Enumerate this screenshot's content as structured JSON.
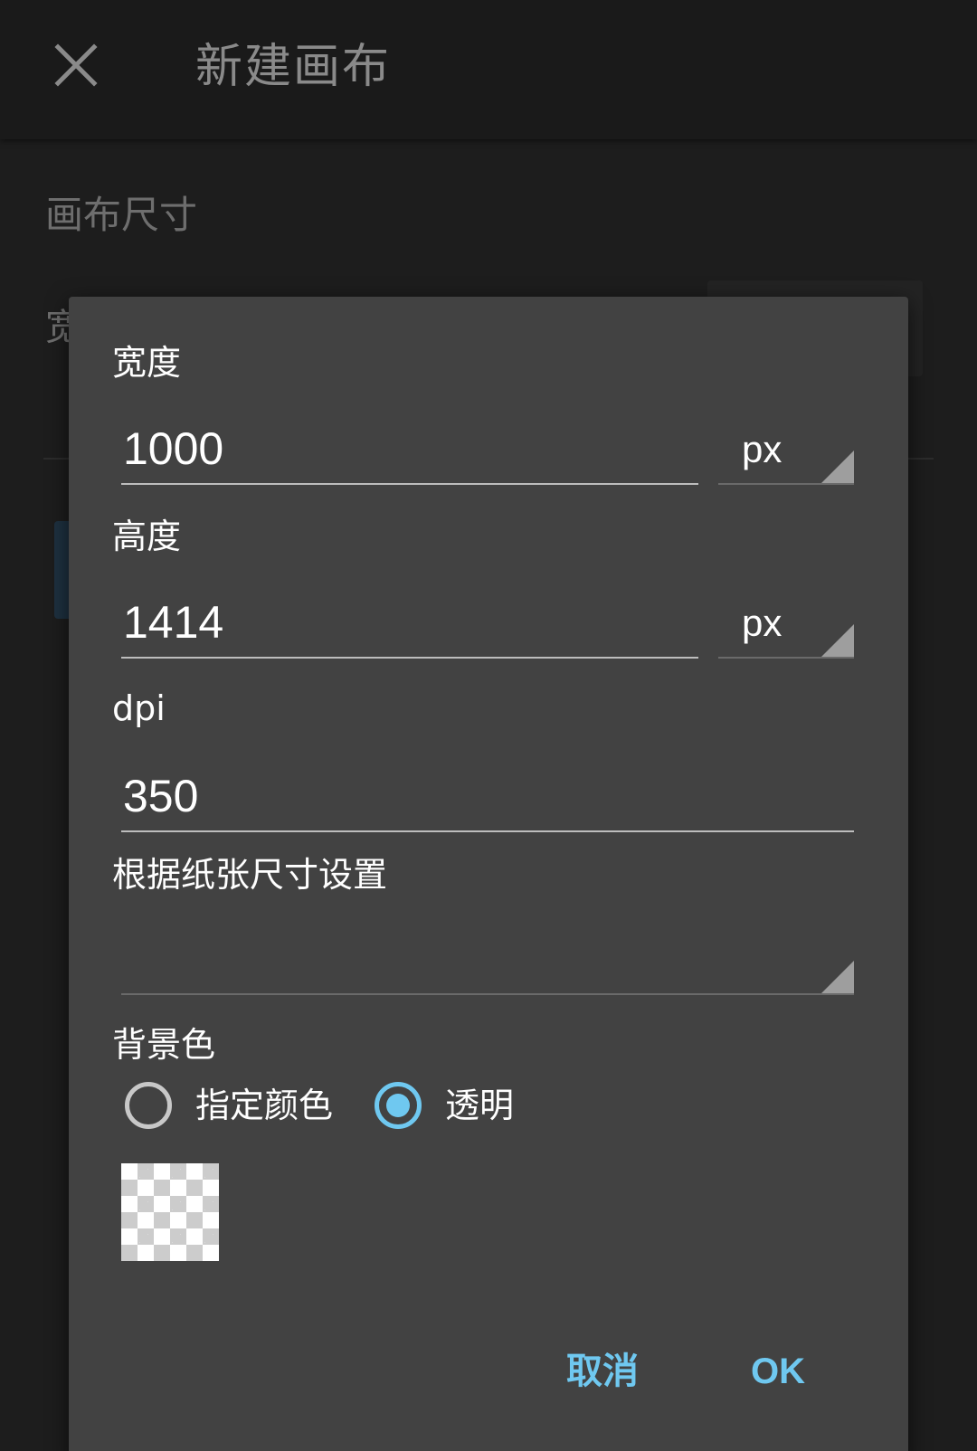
{
  "appbar": {
    "title": "新建画布",
    "close_icon": "close-icon"
  },
  "background": {
    "section_title": "画布尺寸",
    "row_label": "宽"
  },
  "dialog": {
    "width": {
      "label": "宽度",
      "value": "1000",
      "unit": "px"
    },
    "height": {
      "label": "高度",
      "value": "1414",
      "unit": "px"
    },
    "dpi": {
      "label": "dpi",
      "value": "350"
    },
    "paper_size": {
      "label": "根据纸张尺寸设置",
      "value": ""
    },
    "background_color": {
      "label": "背景色",
      "options": [
        {
          "label": "指定颜色",
          "selected": false
        },
        {
          "label": "透明",
          "selected": true
        }
      ]
    },
    "buttons": {
      "cancel": "取消",
      "ok": "OK"
    }
  },
  "colors": {
    "accent": "#6fc8f0",
    "dialog_bg": "#424242",
    "screen_bg": "#1d1d1d"
  }
}
